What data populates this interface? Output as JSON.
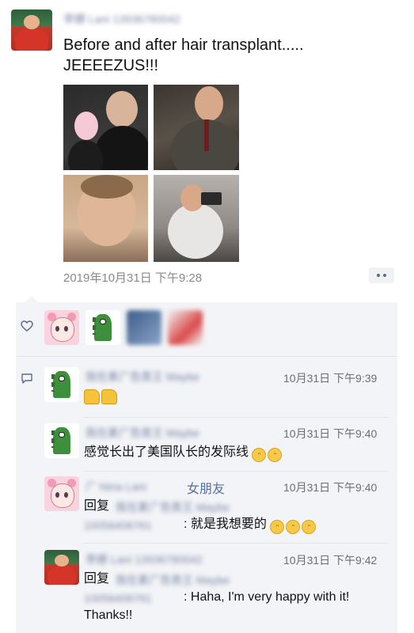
{
  "post": {
    "author_name": "李娜 Lani 13936780042",
    "text_line1": "Before and after hair transplant.....",
    "text_line2": "JEEEEZUS!!!",
    "timestamp": "2019年10月31日 下午9:28"
  },
  "likes": {
    "count_visible": 4
  },
  "comments": [
    {
      "author": "我在素广告类王 Maybe",
      "time": "10月31日 下午9:39",
      "text": "",
      "emojis": [
        "thumbs-up",
        "thumbs-up"
      ]
    },
    {
      "author": "我在素广告类王 Maybe",
      "time": "10月31日 下午9:40",
      "text": "感觉长出了美国队长的发际线",
      "emojis": [
        "grin",
        "grin"
      ]
    },
    {
      "author": "广 Nina Lani",
      "author_tag": "女朋友",
      "time": "10月31日 下午9:40",
      "reply_label": "回复",
      "reply_to": "我在素广告类王 Maybe",
      "text": ": 就是我想要的",
      "emojis": [
        "grin",
        "grin",
        "grin"
      ]
    },
    {
      "author": "李娜 Lani 13936780042",
      "time": "10月31日 下午9:42",
      "reply_label": "回复",
      "reply_to": "我在素广告类王 Maybe",
      "text": ": Haha, I'm very happy with it!",
      "text2": "Thanks!!"
    }
  ],
  "icons": {
    "like": "heart-outline-icon",
    "comment": "comment-bubble-icon",
    "more": "more-dots-icon"
  },
  "colors": {
    "name": "#7a86a6",
    "panel_bg": "#f3f4f7",
    "more_dots": "#5c6b8a"
  }
}
